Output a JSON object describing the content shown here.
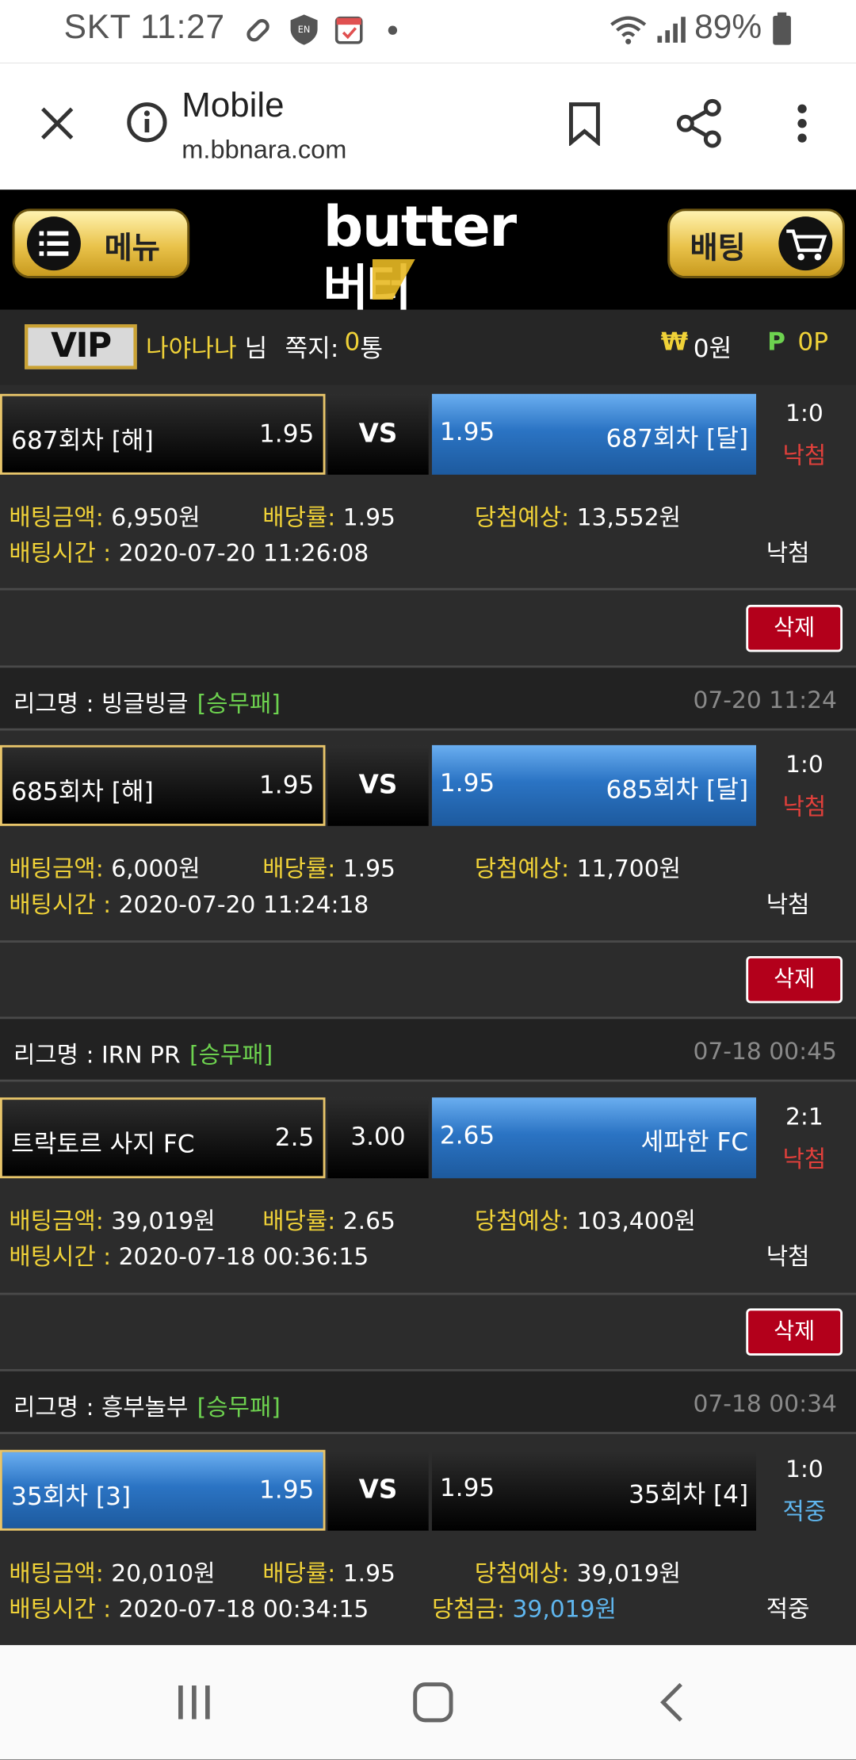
{
  "status_bar": {
    "carrier_time": "SKT 11:27",
    "battery": "89%"
  },
  "browser": {
    "title": "Mobile",
    "url": "m.bbnara.com"
  },
  "header": {
    "menu_label": "메뉴",
    "bet_label": "배팅",
    "logo_top": "butter",
    "logo_bottom": "버터"
  },
  "user": {
    "vip_badge": "VIP",
    "username": "나야나나",
    "suffix": "님",
    "messages_label": "쪽지:",
    "messages_count": "0",
    "messages_unit": "통",
    "won_symbol": "₩",
    "money": "0원",
    "point_symbol": "P",
    "points": "0P"
  },
  "labels": {
    "amount": "배팅금액:",
    "rate": "배당률:",
    "expected": "당첨예상:",
    "time": "배팅시간 :",
    "prize": "당첨금:",
    "delete": "삭제",
    "league_prefix": "리그명 : "
  },
  "bets": [
    {
      "home": "687회차 [해]",
      "home_odds": "1.95",
      "mid": "VS",
      "away_odds": "1.95",
      "away": "687회차 [달]",
      "score": "1:0",
      "result": "낙첨",
      "amount": "6,950원",
      "rate": "1.95",
      "expected": "13,552원",
      "time": "2020-07-20 11:26:08",
      "status": "낙첨",
      "league": "빙글빙글",
      "league_type": "[승무패]",
      "league_date": "07-20 11:24"
    },
    {
      "home": "685회차 [해]",
      "home_odds": "1.95",
      "mid": "VS",
      "away_odds": "1.95",
      "away": "685회차 [달]",
      "score": "1:0",
      "result": "낙첨",
      "amount": "6,000원",
      "rate": "1.95",
      "expected": "11,700원",
      "time": "2020-07-20 11:24:18",
      "status": "낙첨",
      "league": "IRN PR",
      "league_type": "[승무패]",
      "league_date": "07-18 00:45"
    },
    {
      "home": "트락토르 사지 FC",
      "home_odds": "2.5",
      "mid": "3.00",
      "away_odds": "2.65",
      "away": "세파한 FC",
      "score": "2:1",
      "result": "낙첨",
      "amount": "39,019원",
      "rate": "2.65",
      "expected": "103,400원",
      "time": "2020-07-18 00:36:15",
      "status": "낙첨",
      "league": "흥부놀부",
      "league_type": "[승무패]",
      "league_date": "07-18 00:34"
    },
    {
      "home": "35회차 [3]",
      "home_odds": "1.95",
      "mid": "VS",
      "away_odds": "1.95",
      "away": "35회차 [4]",
      "score": "1:0",
      "result": "적중",
      "amount": "20,010원",
      "rate": "1.95",
      "expected": "39,019원",
      "time": "2020-07-18 00:34:15",
      "prize": "39,019원",
      "status": "적중"
    }
  ]
}
